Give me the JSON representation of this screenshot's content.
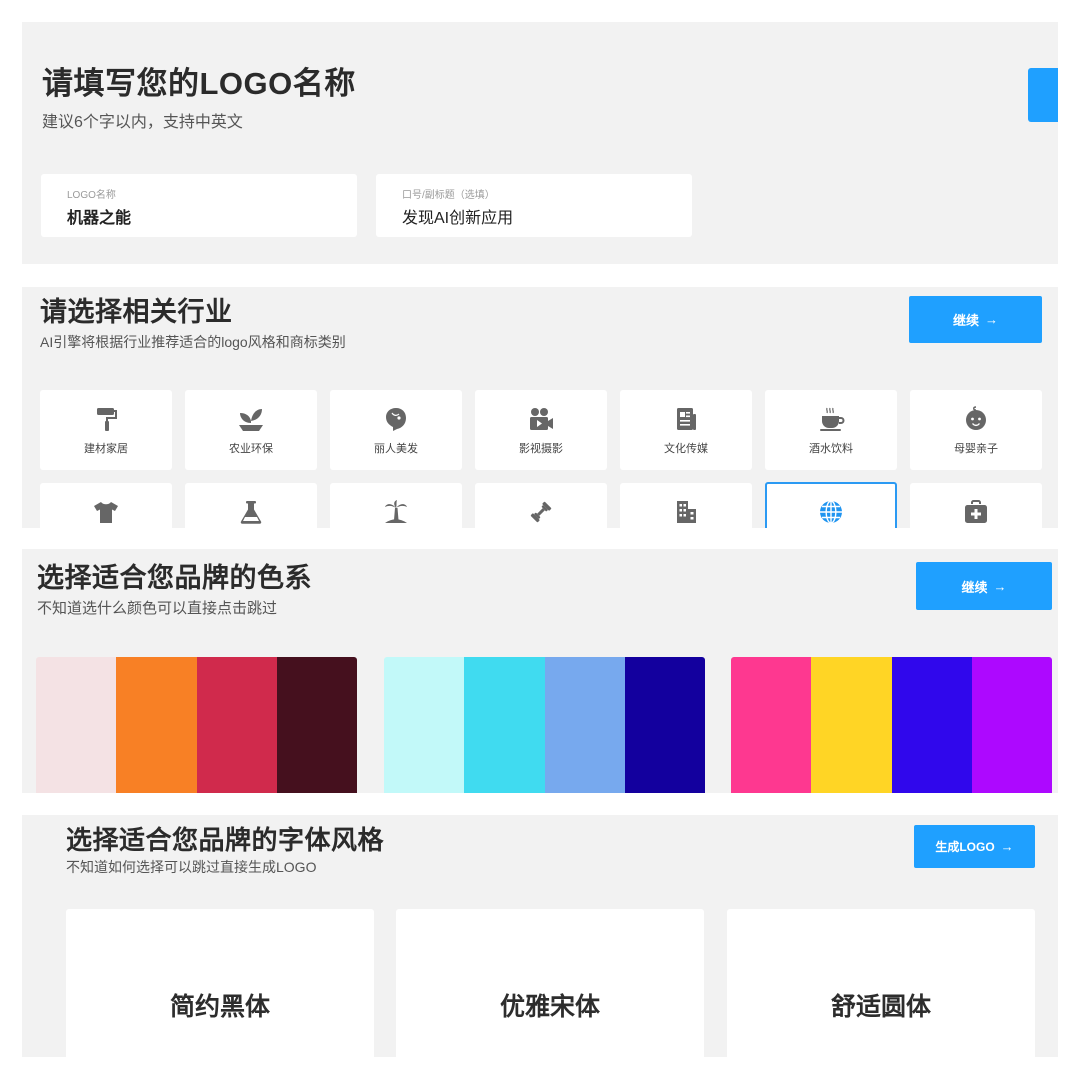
{
  "name_section": {
    "title": "请填写您的LOGO名称",
    "subtitle": "建议6个字以内，支持中英文",
    "name_field": {
      "label": "LOGO名称",
      "value": "机器之能"
    },
    "slogan_field": {
      "label": "口号/副标题（选填）",
      "value": "发现AI创新应用"
    }
  },
  "industry_section": {
    "title": "请选择相关行业",
    "subtitle": "AI引擎将根据行业推荐适合的logo风格和商标类别",
    "continue_label": "继续",
    "accent_color": "#1fa0ff",
    "selected_color": "#2b9af3",
    "icon_color": "#666666",
    "row1": [
      {
        "label": "建材家居",
        "icon": "paint-roller-icon"
      },
      {
        "label": "农业环保",
        "icon": "seedling-icon"
      },
      {
        "label": "丽人美发",
        "icon": "beauty-head-icon"
      },
      {
        "label": "影视摄影",
        "icon": "video-camera-icon"
      },
      {
        "label": "文化传媒",
        "icon": "newspaper-icon"
      },
      {
        "label": "酒水饮料",
        "icon": "coffee-cup-icon"
      },
      {
        "label": "母婴亲子",
        "icon": "baby-face-icon"
      }
    ],
    "row2": [
      {
        "icon": "tshirt-icon"
      },
      {
        "icon": "flask-icon"
      },
      {
        "icon": "palm-tree-icon"
      },
      {
        "icon": "dumbbell-icon"
      },
      {
        "icon": "building-icon"
      },
      {
        "icon": "globe-icon",
        "selected": true
      },
      {
        "icon": "medical-kit-icon"
      }
    ]
  },
  "color_section": {
    "title": "选择适合您品牌的色系",
    "subtitle": "不知道选什么颜色可以直接点击跳过",
    "continue_label": "继续",
    "palettes": [
      {
        "colors": [
          "#f4e2e4",
          "#f88025",
          "#d02a4c",
          "#45101e"
        ]
      },
      {
        "colors": [
          "#c2f9f9",
          "#40dbf0",
          "#77a9ee",
          "#13009e"
        ]
      },
      {
        "colors": [
          "#fe3890",
          "#ffd525",
          "#3007ec",
          "#ad08ff"
        ]
      }
    ]
  },
  "font_section": {
    "title": "选择适合您品牌的字体风格",
    "subtitle": "不知道如何选择可以跳过直接生成LOGO",
    "generate_label": "生成LOGO",
    "styles": [
      {
        "name": "简约黑体"
      },
      {
        "name": "优雅宋体"
      },
      {
        "name": "舒适圆体"
      }
    ]
  }
}
